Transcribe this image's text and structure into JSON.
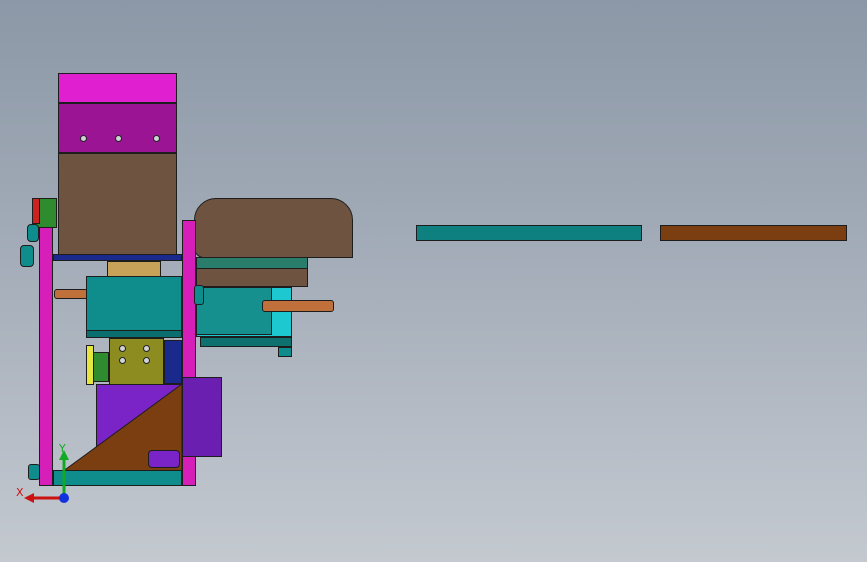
{
  "viewport": {
    "background_top": "#8c98a7",
    "background_bottom": "#c4c9d0"
  },
  "triad": {
    "x_label": "X",
    "y_label": "Y",
    "x_color": "#cc1111",
    "y_color": "#11aa22",
    "z_color": "#1133dd"
  },
  "colors": {
    "magenta": "#e020d0",
    "dark_magenta": "#9a1493",
    "brown": "#6e5440",
    "dark_brown": "#7a3e10",
    "teal": "#0f8c8c",
    "cyan": "#1ec8d0",
    "purple": "#7a24c8",
    "green": "#2e8b2e",
    "red": "#cc2222",
    "olive": "#8c8c20",
    "rod": "#c0703a"
  }
}
